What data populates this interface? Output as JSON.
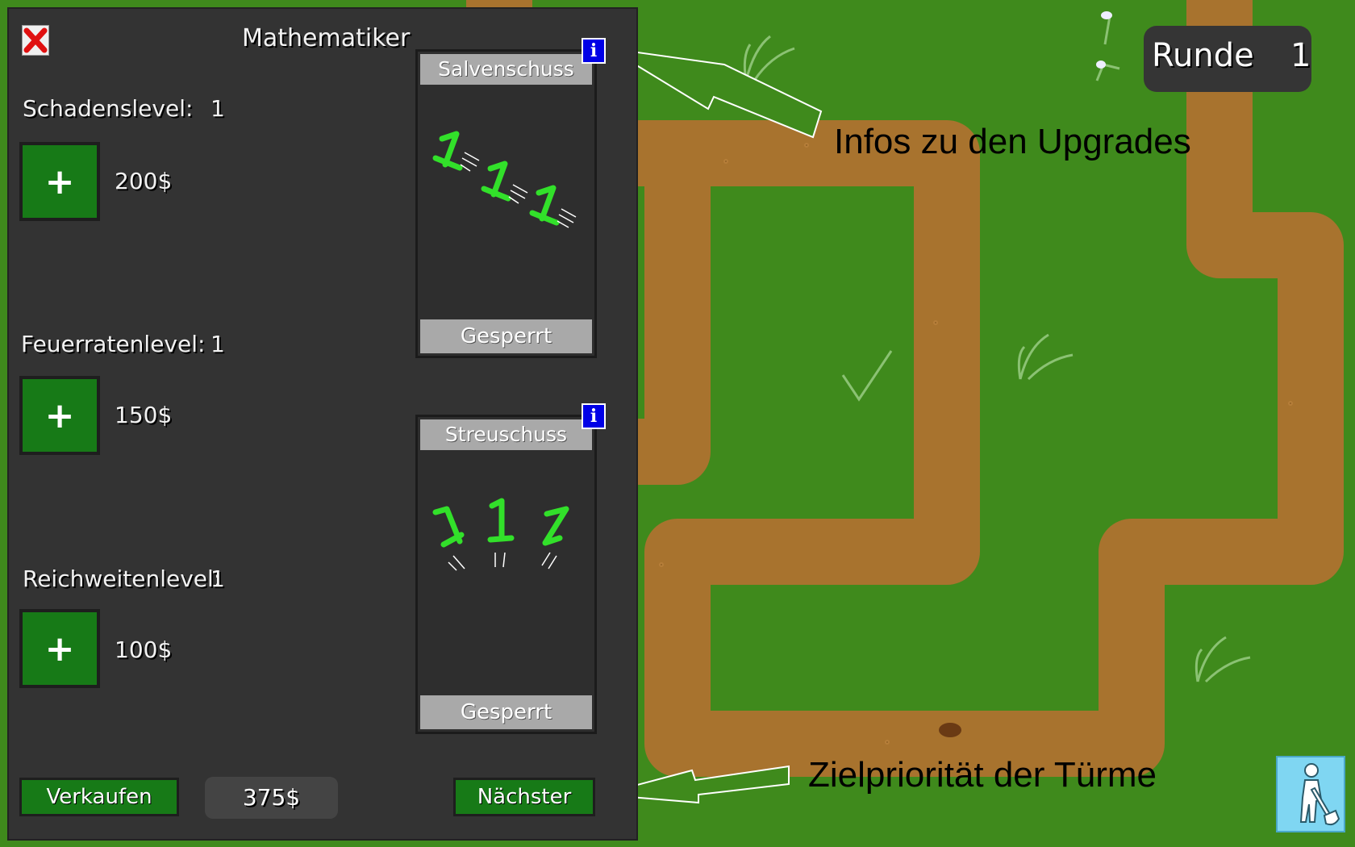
{
  "panel": {
    "title": "Mathematiker",
    "stats": [
      {
        "label": "Schadenslevel:",
        "level": "1",
        "cost": "200$"
      },
      {
        "label": "Feuerratenlevel:",
        "level": "1",
        "cost": "150$"
      },
      {
        "label": "Reichweitenlevel:",
        "level": "1",
        "cost": "100$"
      }
    ],
    "plus_symbol": "+",
    "upgrades": [
      {
        "name": "Salvenschuss",
        "status": "Gesperrt",
        "icon": "salvo-numbers-icon"
      },
      {
        "name": "Streuschuss",
        "status": "Gesperrt",
        "icon": "spread-numbers-icon"
      }
    ],
    "info_symbol": "i",
    "sell_label": "Verkaufen",
    "sell_value": "375$",
    "target_priority": "Nächster"
  },
  "hud": {
    "round_label": "Runde",
    "round_value": "1"
  },
  "annotations": {
    "upgrades_info": "Infos zu den Upgrades",
    "target_priority": "Zielpriorität der Türme"
  },
  "colors": {
    "grass": "#3f8a1c",
    "path": "#a8732e",
    "panel": "#333333",
    "button_green": "#177a17",
    "info_blue": "#0000e6"
  }
}
